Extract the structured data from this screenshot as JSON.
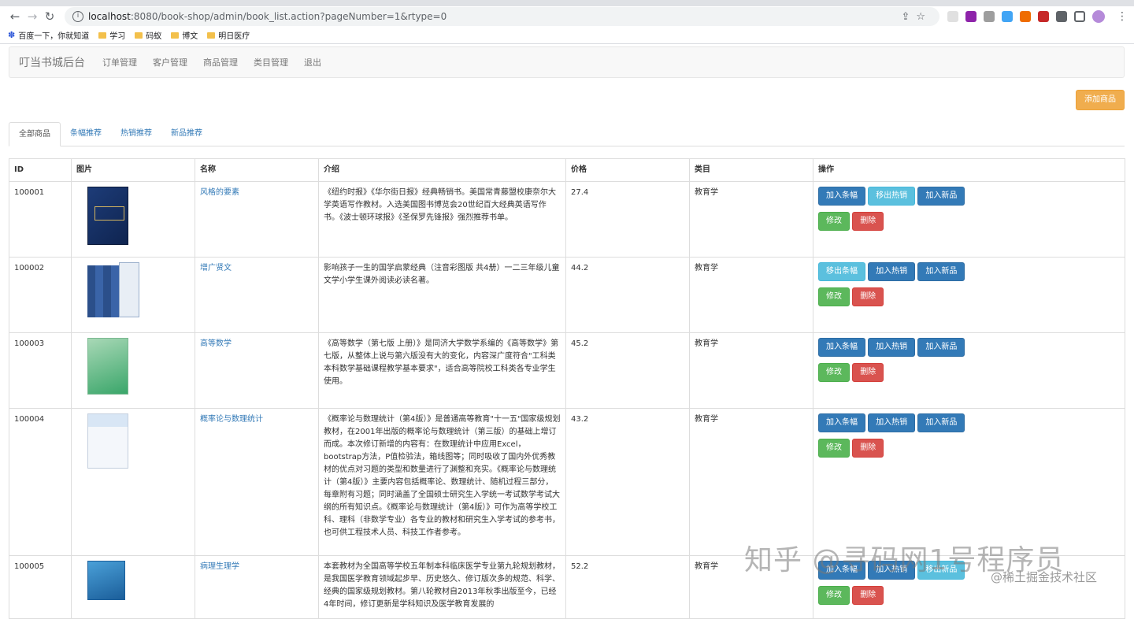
{
  "browser": {
    "url_host": "localhost",
    "url_path": ":8080/book-shop/admin/book_list.action?pageNumber=1&rtype=0",
    "bookmarks": [
      "百度一下，你就知道",
      "学习",
      "码蚁",
      "博文",
      "明日医疗"
    ]
  },
  "navbar": {
    "brand": "叮当书城后台",
    "links": [
      "订单管理",
      "客户管理",
      "商品管理",
      "类目管理",
      "退出"
    ]
  },
  "add_button": "添加商品",
  "tabs": [
    "全部商品",
    "条幅推荐",
    "热销推荐",
    "新品推荐"
  ],
  "table": {
    "headers": [
      "ID",
      "图片",
      "名称",
      "介绍",
      "价格",
      "类目",
      "操作"
    ],
    "rows": [
      {
        "id": "100001",
        "name": "风格的要素",
        "desc": "《纽约时报》《华尔街日报》经典畅销书。美国常青藤盟校康奈尔大学英语写作教材。入选美国图书博览会20世纪百大经典英语写作书。《波士顿环球报》《圣保罗先锋报》强烈推荐书单。",
        "price": "27.4",
        "category": "教育学",
        "b1": "加入条幅",
        "b2": "移出热销",
        "b3": "加入新品"
      },
      {
        "id": "100002",
        "name": "增广贤文",
        "desc": "影响孩子一生的国学启蒙经典（注音彩图版 共4册）一二三年级儿童文学小学生课外阅读必读名著。",
        "price": "44.2",
        "category": "教育学",
        "b1": "移出条幅",
        "b2": "加入热销",
        "b3": "加入新品"
      },
      {
        "id": "100003",
        "name": "高等数学",
        "desc": "《高等数学（第七版 上册）》是同济大学数学系编的《高等数学》第七版，从整体上说与第六版没有大的变化，内容深广度符合\"工科类本科数学基础课程教学基本要求\"，适合高等院校工科类各专业学生使用。",
        "price": "45.2",
        "category": "教育学",
        "b1": "加入条幅",
        "b2": "加入热销",
        "b3": "加入新品"
      },
      {
        "id": "100004",
        "name": "概率论与数理统计",
        "desc": "《概率论与数理统计（第4版）》是普通高等教育\"十一五\"国家级规划教材，在2001年出版的概率论与数理统计（第三版）的基础上增订而成。本次修订新增的内容有：在数理统计中应用Excel，bootstrap方法，P值检验法，箱线图等；同时吸收了国内外优秀教材的优点对习题的类型和数量进行了渊整和充实。《概率论与数理统计（第4版）》主要内容包括概率论、数理统计、随机过程三部分，每章附有习题；同时涵盖了全国硕士研究生入学统一考试数学考试大纲的所有知识点。《概率论与数理统计（第4版）》可作为高等学校工科、理科（非数学专业）各专业的教材和研究生入学考试的参考书，也可供工程技术人员、科技工作者参考。",
        "price": "43.2",
        "category": "教育学",
        "b1": "加入条幅",
        "b2": "加入热销",
        "b3": "加入新品"
      },
      {
        "id": "100005",
        "name": "病理生理学",
        "desc": "本套教材为全国高等学校五年制本科临床医学专业第九轮规划教材，是我国医学教育领域起步早、历史悠久、修订版次多的规范、科学、经典的国家级规划教材。第八轮教材自2013年秋季出版至今，已经4年时间，修订更新是学科知识及医学教育发展的",
        "price": "52.2",
        "category": "教育学",
        "b1": "加入条幅",
        "b2": "加入热销",
        "b3": "移出新品"
      }
    ],
    "edit_label": "修改",
    "delete_label": "删除"
  },
  "watermark": "知乎 @寻码网1号程序员",
  "watermark2": "@稀土掘金技术社区"
}
